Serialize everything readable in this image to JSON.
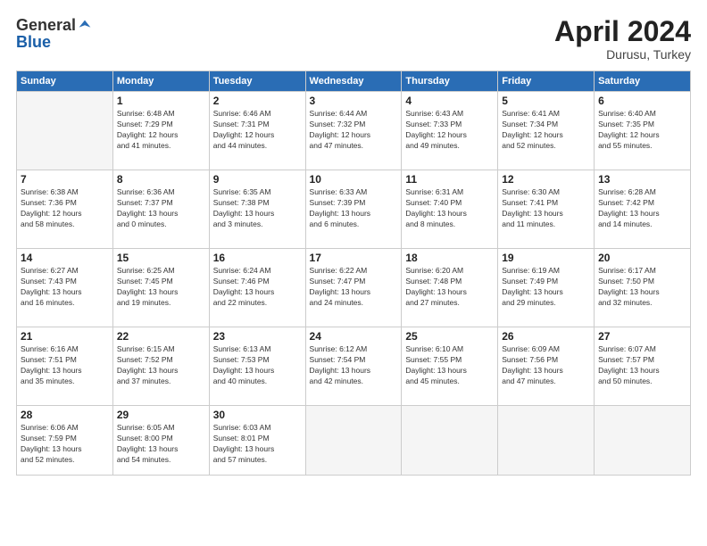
{
  "logo": {
    "general": "General",
    "blue": "Blue"
  },
  "title": {
    "month_year": "April 2024",
    "location": "Durusu, Turkey"
  },
  "weekdays": [
    "Sunday",
    "Monday",
    "Tuesday",
    "Wednesday",
    "Thursday",
    "Friday",
    "Saturday"
  ],
  "weeks": [
    [
      {
        "day": "",
        "info": ""
      },
      {
        "day": "1",
        "info": "Sunrise: 6:48 AM\nSunset: 7:29 PM\nDaylight: 12 hours\nand 41 minutes."
      },
      {
        "day": "2",
        "info": "Sunrise: 6:46 AM\nSunset: 7:31 PM\nDaylight: 12 hours\nand 44 minutes."
      },
      {
        "day": "3",
        "info": "Sunrise: 6:44 AM\nSunset: 7:32 PM\nDaylight: 12 hours\nand 47 minutes."
      },
      {
        "day": "4",
        "info": "Sunrise: 6:43 AM\nSunset: 7:33 PM\nDaylight: 12 hours\nand 49 minutes."
      },
      {
        "day": "5",
        "info": "Sunrise: 6:41 AM\nSunset: 7:34 PM\nDaylight: 12 hours\nand 52 minutes."
      },
      {
        "day": "6",
        "info": "Sunrise: 6:40 AM\nSunset: 7:35 PM\nDaylight: 12 hours\nand 55 minutes."
      }
    ],
    [
      {
        "day": "7",
        "info": "Sunrise: 6:38 AM\nSunset: 7:36 PM\nDaylight: 12 hours\nand 58 minutes."
      },
      {
        "day": "8",
        "info": "Sunrise: 6:36 AM\nSunset: 7:37 PM\nDaylight: 13 hours\nand 0 minutes."
      },
      {
        "day": "9",
        "info": "Sunrise: 6:35 AM\nSunset: 7:38 PM\nDaylight: 13 hours\nand 3 minutes."
      },
      {
        "day": "10",
        "info": "Sunrise: 6:33 AM\nSunset: 7:39 PM\nDaylight: 13 hours\nand 6 minutes."
      },
      {
        "day": "11",
        "info": "Sunrise: 6:31 AM\nSunset: 7:40 PM\nDaylight: 13 hours\nand 8 minutes."
      },
      {
        "day": "12",
        "info": "Sunrise: 6:30 AM\nSunset: 7:41 PM\nDaylight: 13 hours\nand 11 minutes."
      },
      {
        "day": "13",
        "info": "Sunrise: 6:28 AM\nSunset: 7:42 PM\nDaylight: 13 hours\nand 14 minutes."
      }
    ],
    [
      {
        "day": "14",
        "info": "Sunrise: 6:27 AM\nSunset: 7:43 PM\nDaylight: 13 hours\nand 16 minutes."
      },
      {
        "day": "15",
        "info": "Sunrise: 6:25 AM\nSunset: 7:45 PM\nDaylight: 13 hours\nand 19 minutes."
      },
      {
        "day": "16",
        "info": "Sunrise: 6:24 AM\nSunset: 7:46 PM\nDaylight: 13 hours\nand 22 minutes."
      },
      {
        "day": "17",
        "info": "Sunrise: 6:22 AM\nSunset: 7:47 PM\nDaylight: 13 hours\nand 24 minutes."
      },
      {
        "day": "18",
        "info": "Sunrise: 6:20 AM\nSunset: 7:48 PM\nDaylight: 13 hours\nand 27 minutes."
      },
      {
        "day": "19",
        "info": "Sunrise: 6:19 AM\nSunset: 7:49 PM\nDaylight: 13 hours\nand 29 minutes."
      },
      {
        "day": "20",
        "info": "Sunrise: 6:17 AM\nSunset: 7:50 PM\nDaylight: 13 hours\nand 32 minutes."
      }
    ],
    [
      {
        "day": "21",
        "info": "Sunrise: 6:16 AM\nSunset: 7:51 PM\nDaylight: 13 hours\nand 35 minutes."
      },
      {
        "day": "22",
        "info": "Sunrise: 6:15 AM\nSunset: 7:52 PM\nDaylight: 13 hours\nand 37 minutes."
      },
      {
        "day": "23",
        "info": "Sunrise: 6:13 AM\nSunset: 7:53 PM\nDaylight: 13 hours\nand 40 minutes."
      },
      {
        "day": "24",
        "info": "Sunrise: 6:12 AM\nSunset: 7:54 PM\nDaylight: 13 hours\nand 42 minutes."
      },
      {
        "day": "25",
        "info": "Sunrise: 6:10 AM\nSunset: 7:55 PM\nDaylight: 13 hours\nand 45 minutes."
      },
      {
        "day": "26",
        "info": "Sunrise: 6:09 AM\nSunset: 7:56 PM\nDaylight: 13 hours\nand 47 minutes."
      },
      {
        "day": "27",
        "info": "Sunrise: 6:07 AM\nSunset: 7:57 PM\nDaylight: 13 hours\nand 50 minutes."
      }
    ],
    [
      {
        "day": "28",
        "info": "Sunrise: 6:06 AM\nSunset: 7:59 PM\nDaylight: 13 hours\nand 52 minutes."
      },
      {
        "day": "29",
        "info": "Sunrise: 6:05 AM\nSunset: 8:00 PM\nDaylight: 13 hours\nand 54 minutes."
      },
      {
        "day": "30",
        "info": "Sunrise: 6:03 AM\nSunset: 8:01 PM\nDaylight: 13 hours\nand 57 minutes."
      },
      {
        "day": "",
        "info": ""
      },
      {
        "day": "",
        "info": ""
      },
      {
        "day": "",
        "info": ""
      },
      {
        "day": "",
        "info": ""
      }
    ]
  ]
}
